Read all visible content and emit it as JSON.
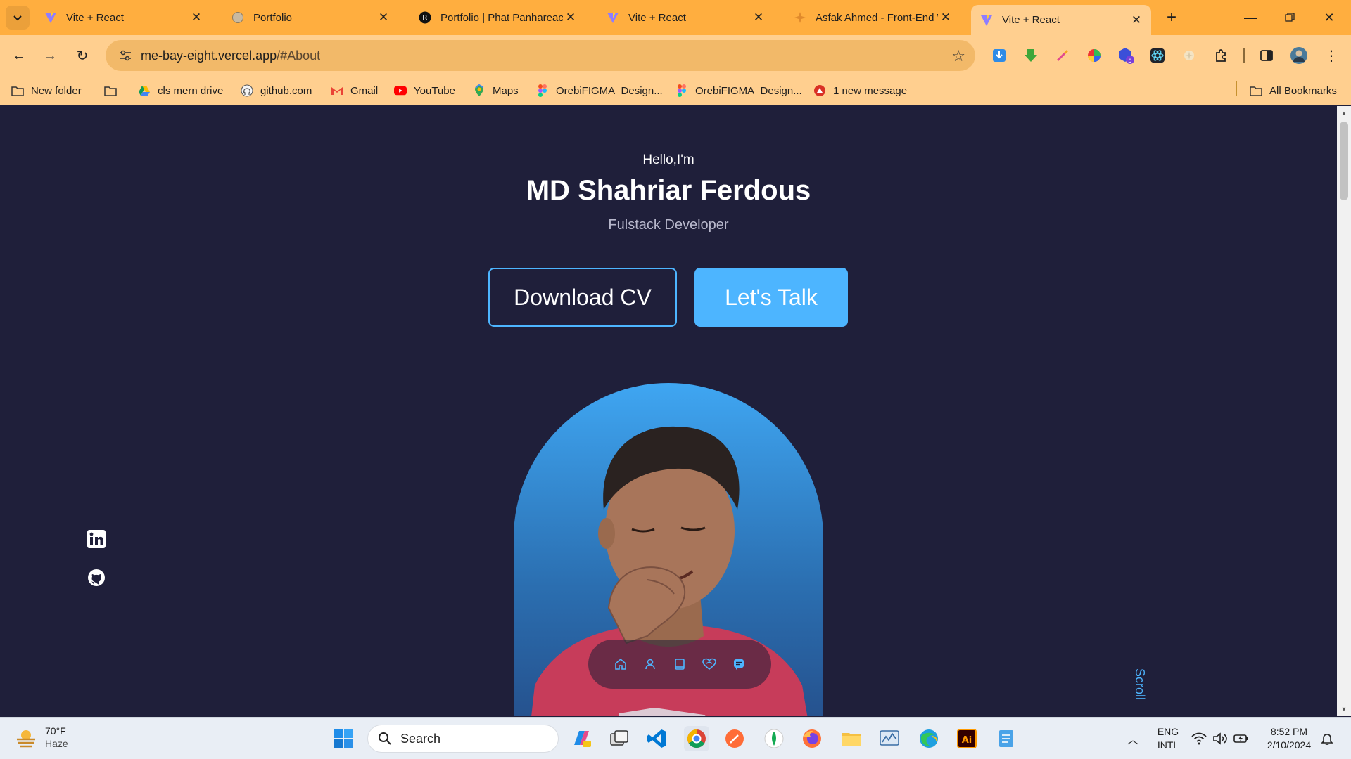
{
  "browser": {
    "tabs": [
      {
        "title": "Vite + React",
        "favicon": "vite-icon",
        "active": false
      },
      {
        "title": "Portfolio",
        "favicon": "globe-icon",
        "active": false
      },
      {
        "title": "Portfolio | Phat Panhareach",
        "favicon": "r-logo-icon",
        "active": false
      },
      {
        "title": "Vite + React",
        "favicon": "vite-icon",
        "active": false
      },
      {
        "title": "Asfak Ahmed - Front-End W",
        "favicon": "sparkle-icon",
        "active": false
      },
      {
        "title": "Vite + React",
        "favicon": "vite-icon",
        "active": true
      }
    ],
    "address": {
      "host": "me-bay-eight.vercel.app",
      "path": "/#About"
    },
    "bookmarks": [
      {
        "label": "New folder",
        "icon": "folder-icon"
      },
      {
        "label": "",
        "icon": "folder-icon"
      },
      {
        "label": "cls mern drive",
        "icon": "google-drive-icon"
      },
      {
        "label": "github.com",
        "icon": "github-icon"
      },
      {
        "label": "Gmail",
        "icon": "gmail-icon"
      },
      {
        "label": "YouTube",
        "icon": "youtube-icon"
      },
      {
        "label": "Maps",
        "icon": "maps-icon"
      },
      {
        "label": "OrebiFIGMA_Design...",
        "icon": "figma-icon"
      },
      {
        "label": "OrebiFIGMA_Design...",
        "icon": "figma-icon"
      },
      {
        "label": "1 new message",
        "icon": "message-icon"
      }
    ],
    "all_bookmarks": "All Bookmarks",
    "extension_badge": "5",
    "colors": {
      "tabbar": "#ffae3f",
      "toolbar": "#ffcf8f",
      "omnibox": "#f2b969"
    }
  },
  "hero": {
    "greeting": "Hello,I'm",
    "name": "MD Shahriar Ferdous",
    "role": "Fulstack Developer",
    "download_cv": "Download CV",
    "lets_talk": "Let's Talk",
    "scroll": "Scroll",
    "colors": {
      "background": "#1f1f3a",
      "accent": "#4db5ff"
    }
  },
  "social": [
    "linkedin-icon",
    "github-icon"
  ],
  "float_nav": [
    "home-icon",
    "user-icon",
    "book-icon",
    "services-icon",
    "message-icon"
  ],
  "taskbar": {
    "weather": {
      "temp": "70°F",
      "condition": "Haze"
    },
    "search_label": "Search",
    "lang_top": "ENG",
    "lang_bottom": "INTL",
    "time": "8:52 PM",
    "date": "2/10/2024"
  }
}
